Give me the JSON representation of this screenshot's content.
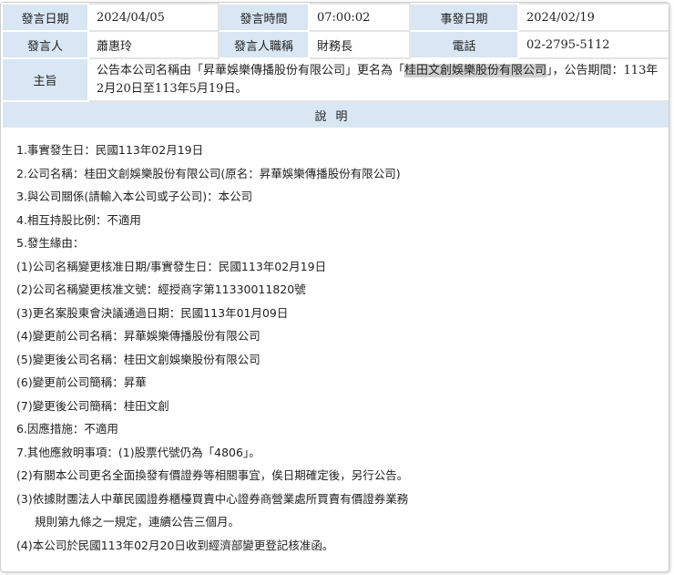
{
  "header": {
    "speak_date_label": "發言日期",
    "speak_date": "2024/04/05",
    "speak_time_label": "發言時間",
    "speak_time": "07:00:02",
    "event_date_label": "事發日期",
    "event_date": "2024/02/19",
    "speaker_label": "發言人",
    "speaker": "蕭惠玲",
    "speaker_title_label": "發言人職稱",
    "speaker_title": "財務長",
    "phone_label": "電話",
    "phone": "02-2795-5112",
    "subject_label": "主旨",
    "subject_pre": "公告本公司名稱由「昇華娛樂傳播股份有限公司」更名為「",
    "subject_highlight": "桂田文創娛樂股份有限公司",
    "subject_post": "」，公告期間：113年2月20日至113年5月19日。"
  },
  "description": {
    "title": "說明",
    "lines": [
      "1.事實發生日：民國113年02月19日",
      "2.公司名稱：桂田文創娛樂股份有限公司(原名：昇華娛樂傳播股份有限公司)",
      "3.與公司關係(請輸入本公司或子公司)：本公司",
      "4.相互持股比例：不適用",
      "5.發生緣由：",
      "(1)公司名稱變更核准日期/事實發生日：民國113年02月19日",
      "(2)公司名稱變更核准文號：經授商字第11330011820號",
      "(3)更名案股東會決議通過日期：民國113年01月09日",
      "(4)變更前公司名稱：昇華娛樂傳播股份有限公司",
      "(5)變更後公司名稱：桂田文創娛樂股份有限公司",
      "(6)變更前公司簡稱：昇華",
      "(7)變更後公司簡稱：桂田文創",
      "6.因應措施：不適用",
      "7.其他應敘明事項：(1)股票代號仍為「4806」。",
      "(2)有關本公司更名全面換發有價證券等相關事宜，俟日期確定後，另行公告。",
      "(3)依據財團法人中華民國證券櫃檯買賣中心證券商營業處所買賣有價證券業務",
      "規則第九條之一規定，連續公告三個月。",
      "(4)本公司於民國113年02月20日收到經濟部變更登記核准函。"
    ]
  }
}
